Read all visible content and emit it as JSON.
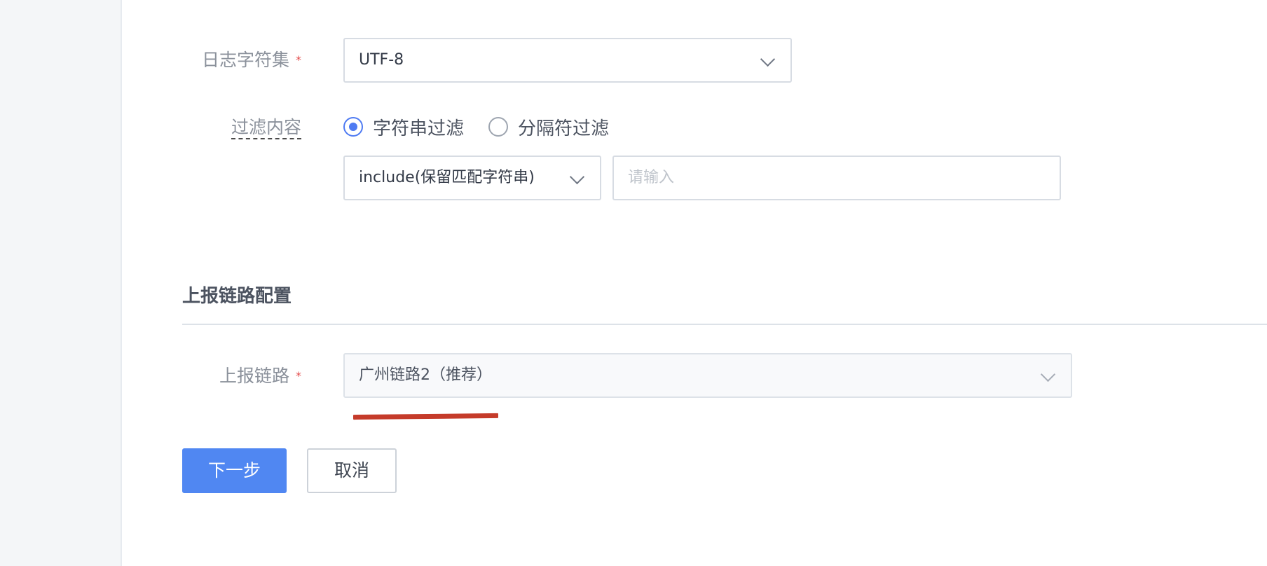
{
  "form": {
    "log_charset": {
      "label": "日志字符集",
      "required_mark": "*",
      "value": "UTF-8"
    },
    "filter_content": {
      "label": "过滤内容",
      "options": [
        {
          "label": "字符串过滤",
          "selected": true
        },
        {
          "label": "分隔符过滤",
          "selected": false
        }
      ],
      "filter_mode": "include(保留匹配字符串)",
      "input_placeholder": "请输入"
    }
  },
  "report_section": {
    "title": "上报链路配置",
    "report_link": {
      "label": "上报链路",
      "required_mark": "*",
      "value": "广州链路2（推荐）"
    }
  },
  "actions": {
    "next_label": "下一步",
    "cancel_label": "取消"
  },
  "colors": {
    "primary": "#5087f2",
    "required": "#e44b4b",
    "annotation_underline": "#c53b2a",
    "radio_selected": "#4f7bf2"
  },
  "icons": {
    "select_arrow": "chevron-down-icon"
  }
}
